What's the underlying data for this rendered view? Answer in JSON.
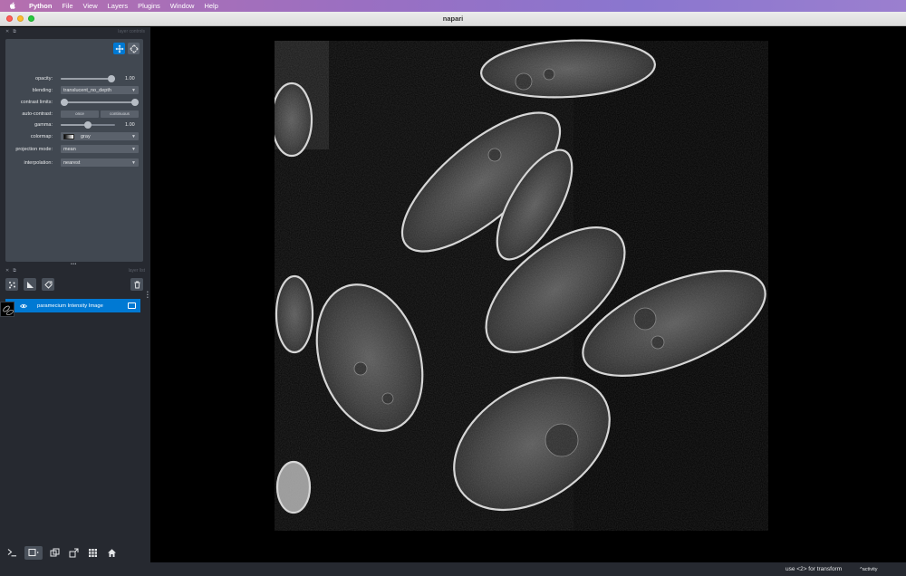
{
  "menubar": {
    "app_name": "Python",
    "items": [
      "File",
      "View",
      "Layers",
      "Plugins",
      "Window",
      "Help"
    ]
  },
  "window": {
    "title": "napari"
  },
  "dock": {
    "controls_title": "layer controls",
    "layerlist_title": "layer list",
    "controls": {
      "opacity_label": "opacity:",
      "opacity_value": "1.00",
      "opacity_fraction": 1.0,
      "blending_label": "blending:",
      "blending_value": "translucent_no_depth",
      "contrast_label": "contrast limits:",
      "contrast_range": [
        0.0,
        1.0
      ],
      "autocontrast_label": "auto-contrast:",
      "autocontrast_once": "once",
      "autocontrast_continuous": "continuous",
      "gamma_label": "gamma:",
      "gamma_value": "1.00",
      "gamma_fraction": 0.5,
      "colormap_label": "colormap:",
      "colormap_value": "gray",
      "projection_label": "projection mode:",
      "projection_value": "mean",
      "interpolation_label": "interpolation:",
      "interpolation_value": "nearest"
    },
    "layers": [
      {
        "name": "paramecium Intensity Image",
        "visible": true,
        "selected": true
      }
    ]
  },
  "status": {
    "hint": "use <2> for transform",
    "activity_label": "activity"
  },
  "colors": {
    "accent": "#0079d3",
    "panel": "#414851",
    "dock_bg": "#262930"
  }
}
